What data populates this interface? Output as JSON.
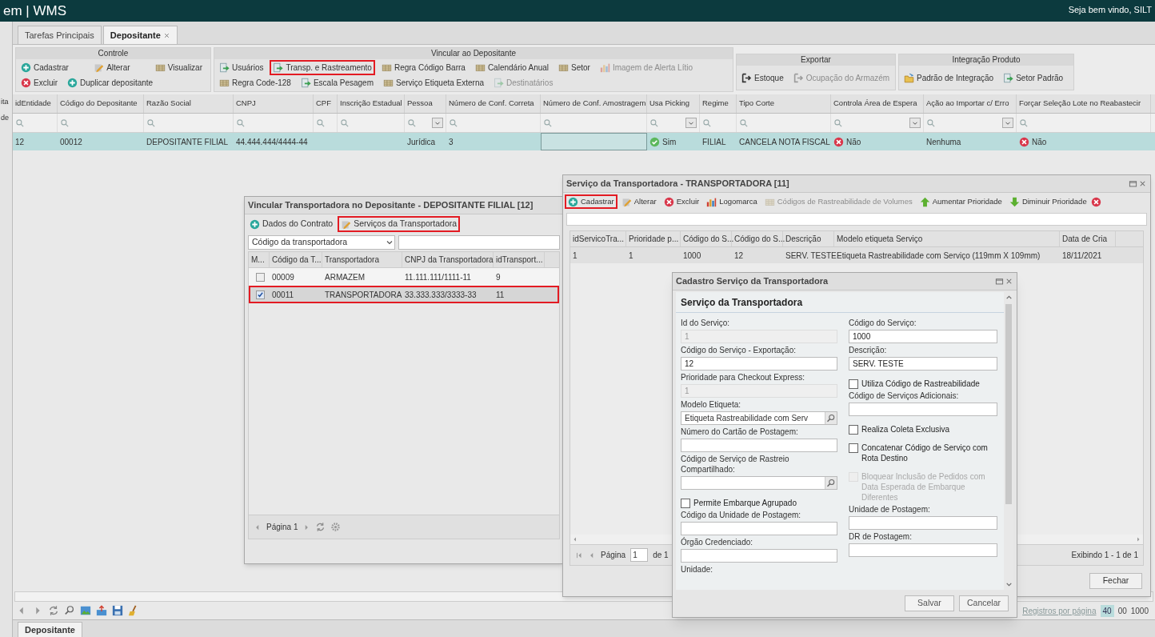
{
  "app": {
    "title": "em | WMS",
    "welcome": "Seja bem vindo, SILT"
  },
  "left_edge": [
    "ita",
    "de"
  ],
  "tabs": [
    {
      "label": "Tarefas Principais",
      "selected": false,
      "closable": false
    },
    {
      "label": "Depositante",
      "selected": true,
      "closable": true
    }
  ],
  "ribbon": {
    "groups": [
      {
        "title": "Controle",
        "rows": [
          [
            {
              "label": "Cadastrar",
              "kind": "add",
              "disabled": false,
              "highlighted": false
            },
            {
              "label": "Alterar",
              "kind": "edit",
              "disabled": false,
              "highlighted": false
            },
            {
              "label": "Visualizar",
              "kind": "table",
              "disabled": false,
              "highlighted": false
            }
          ],
          [
            {
              "label": "Excluir",
              "kind": "delete",
              "disabled": false,
              "highlighted": false
            },
            {
              "label": "Duplicar depositante",
              "kind": "add",
              "disabled": false,
              "highlighted": false
            }
          ]
        ]
      },
      {
        "title": "Vincular ao Depositante",
        "rows": [
          [
            {
              "label": "Usuários",
              "kind": "doc",
              "disabled": false,
              "highlighted": false
            },
            {
              "label": "Transp. e Rastreamento",
              "kind": "doc",
              "disabled": false,
              "highlighted": true
            },
            {
              "label": "Regra Código Barra",
              "kind": "table",
              "disabled": false,
              "highlighted": false
            },
            {
              "label": "Calendário Anual",
              "kind": "table",
              "disabled": false,
              "highlighted": false
            },
            {
              "label": "Setor",
              "kind": "table",
              "disabled": false,
              "highlighted": false
            },
            {
              "label": "Imagem de Alerta Lítio",
              "kind": "chart",
              "disabled": true,
              "highlighted": false
            }
          ],
          [
            {
              "label": "Regra Code-128",
              "kind": "table",
              "disabled": false,
              "highlighted": false
            },
            {
              "label": "Escala Pesagem",
              "kind": "doc",
              "disabled": false,
              "highlighted": false
            },
            {
              "label": "Serviço Etiqueta Externa",
              "kind": "table",
              "disabled": false,
              "highlighted": false
            },
            {
              "label": "Destinatários",
              "kind": "doc",
              "disabled": true,
              "highlighted": false
            }
          ]
        ]
      },
      {
        "title": "Exportar",
        "rows": [
          [
            {
              "label": "Estoque",
              "kind": "export",
              "disabled": false,
              "highlighted": false
            },
            {
              "label": "Ocupação do Armazém",
              "kind": "export",
              "disabled": true,
              "highlighted": false
            }
          ]
        ]
      },
      {
        "title": "Integração Produto",
        "rows": [
          [
            {
              "label": "Padrão de Integração",
              "kind": "folder",
              "disabled": false,
              "highlighted": false
            },
            {
              "label": "Setor Padrão",
              "kind": "doc",
              "disabled": false,
              "highlighted": false
            }
          ]
        ]
      }
    ]
  },
  "grid": {
    "columns": [
      {
        "label": "idEntidade",
        "kind": "text"
      },
      {
        "label": "Código do Depositante",
        "kind": "text"
      },
      {
        "label": "Razão Social",
        "kind": "text"
      },
      {
        "label": "CNPJ",
        "kind": "text"
      },
      {
        "label": "CPF",
        "kind": "text"
      },
      {
        "label": "Inscrição Estadual",
        "kind": "text"
      },
      {
        "label": "Pessoa",
        "kind": "dropdown"
      },
      {
        "label": "Número de Conf. Correta",
        "kind": "text"
      },
      {
        "label": "Número de Conf. Amostragem",
        "kind": "text"
      },
      {
        "label": "Usa Picking",
        "kind": "dropdown"
      },
      {
        "label": "Regime",
        "kind": "text"
      },
      {
        "label": "Tipo Corte",
        "kind": "text"
      },
      {
        "label": "Controla Área de Espera",
        "kind": "dropdown"
      },
      {
        "label": "Ação ao Importar c/ Erro",
        "kind": "dropdown"
      },
      {
        "label": "Forçar Seleção Lote no Reabastecir",
        "kind": "text"
      }
    ],
    "rows": [
      {
        "selected": true,
        "cells": [
          {
            "text": "12"
          },
          {
            "text": "00012"
          },
          {
            "text": "DEPOSITANTE FILIAL"
          },
          {
            "text": "44.444.444/4444-44"
          },
          {},
          {},
          {
            "text": "Jurídica"
          },
          {
            "text": "3"
          },
          {
            "editing": true
          },
          {
            "text": "Sim",
            "kind": "yes"
          },
          {
            "text": "FILIAL"
          },
          {
            "text": "CANCELA NOTA FISCAL"
          },
          {
            "text": "Não",
            "kind": "no"
          },
          {
            "text": "Nenhuma"
          },
          {
            "text": "Não",
            "kind": "no"
          }
        ]
      }
    ]
  },
  "bottom": {
    "per_page_label": "Registros por página",
    "per_page": [
      {
        "label": "40",
        "selected": true
      },
      {
        "label": "00",
        "selected": false
      },
      {
        "label": "1000",
        "selected": false
      }
    ],
    "tab": "Depositante"
  },
  "carrier_window": {
    "title": "Vincular Transportadora no Depositante - DEPOSITANTE FILIAL [12]",
    "toolbar": [
      {
        "label": "Dados do Contrato",
        "kind": "add",
        "highlighted": false
      },
      {
        "label": "Serviços da Transportadora",
        "kind": "edit",
        "highlighted": true
      }
    ],
    "filter_field": "Código da transportadora",
    "checkbox_column": "M...",
    "columns": [
      "Código da T...",
      "Transportadora",
      "CNPJ da Transportadora",
      "idTransport..."
    ],
    "rows": [
      {
        "checked": false,
        "selected": false,
        "highlighted": false,
        "cells": [
          "00009",
          "ARMAZEM",
          "11.111.111/1111-11",
          "9"
        ]
      },
      {
        "checked": true,
        "selected": true,
        "highlighted": true,
        "cells": [
          "00011",
          "TRANSPORTADORA",
          "33.333.333/3333-33",
          "11"
        ]
      }
    ],
    "pager": "Página 1"
  },
  "service_window": {
    "title": "Serviço da Transportadora - TRANSPORTADORA [11]",
    "toolbar": [
      {
        "label": "Cadastrar",
        "kind": "add",
        "disabled": false,
        "highlighted": true
      },
      {
        "label": "Alterar",
        "kind": "edit",
        "disabled": false,
        "highlighted": false
      },
      {
        "label": "Excluir",
        "kind": "delete",
        "disabled": false,
        "highlighted": false
      },
      {
        "label": "Logomarca",
        "kind": "chart",
        "disabled": false,
        "highlighted": false
      },
      {
        "label": "Códigos de Rastreabilidade de Volumes",
        "kind": "table",
        "disabled": true,
        "highlighted": false
      },
      {
        "label": "Aumentar Prioridade",
        "kind": "up",
        "disabled": false,
        "highlighted": false
      },
      {
        "label": "Diminuir Prioridade",
        "kind": "down",
        "disabled": false,
        "highlighted": false
      }
    ],
    "columns": [
      "idServicoTra...",
      "Prioridade p...",
      "Código do S...",
      "Código do S...",
      "Descrição",
      "Modelo etiqueta Serviço",
      "Data de Cria"
    ],
    "rows": [
      [
        "1",
        "1",
        "1000",
        "12",
        "SERV. TESTE",
        "Etiqueta Rastreabilidade com Serviço (119mm X 109mm)",
        "18/11/2021"
      ]
    ],
    "pager": {
      "label": "Página",
      "page": "1",
      "of": "de 1",
      "summary": "Exibindo 1 - 1 de 1"
    },
    "close_button": "Fechar"
  },
  "form_window": {
    "title": "Cadastro Serviço da Transportadora",
    "heading": "Serviço da Transportadora",
    "left_column": [
      {
        "kind": "field",
        "label": "Id do Serviço:",
        "value": "1",
        "disabled": true
      },
      {
        "kind": "field",
        "label": "Código do Serviço - Exportação:",
        "value": "12",
        "disabled": false
      },
      {
        "kind": "field",
        "label": "Prioridade para Checkout Express:",
        "value": "1",
        "disabled": true
      },
      {
        "kind": "lookup",
        "label": "Modelo Etiqueta:",
        "value": "Etiqueta Rastreabilidade com Serv"
      },
      {
        "kind": "field",
        "label": "Número do Cartão de Postagem:",
        "disabled": false
      },
      {
        "kind": "lookup",
        "label": "Código de Serviço de Rastreio Compartilhado:"
      },
      {
        "kind": "checkbox",
        "label": "Permite Embarque Agrupado",
        "checked": false,
        "disabled": false
      },
      {
        "kind": "field",
        "label": "Código da Unidade de Postagem:",
        "disabled": false
      },
      {
        "kind": "field",
        "label": "Órgão Credenciado:",
        "disabled": false
      },
      {
        "kind": "label",
        "label": "Unidade:"
      }
    ],
    "right_column": [
      {
        "kind": "field",
        "label": "Código do Serviço:",
        "value": "1000",
        "disabled": false
      },
      {
        "kind": "field",
        "label": "Descrição:",
        "value": "SERV. TESTE",
        "disabled": false
      },
      {
        "kind": "checkbox",
        "label": "Utiliza Código de Rastreabilidade",
        "checked": false,
        "disabled": false
      },
      {
        "kind": "field",
        "label": "Código de Serviços Adicionais:",
        "disabled": false
      },
      {
        "kind": "checkbox",
        "label": "Realiza Coleta Exclusiva",
        "checked": false,
        "disabled": false
      },
      {
        "kind": "checkbox",
        "label": "Concatenar Código de Serviço com Rota Destino",
        "checked": false,
        "disabled": false
      },
      {
        "kind": "checkbox",
        "label": "Bloquear Inclusão de Pedidos com Data Esperada de Embarque Diferentes",
        "checked": false,
        "disabled": true
      },
      {
        "kind": "field",
        "label": "Unidade de Postagem:",
        "disabled": false
      },
      {
        "kind": "field",
        "label": "DR de Postagem:",
        "disabled": false
      }
    ],
    "buttons": [
      "Salvar",
      "Cancelar"
    ]
  }
}
